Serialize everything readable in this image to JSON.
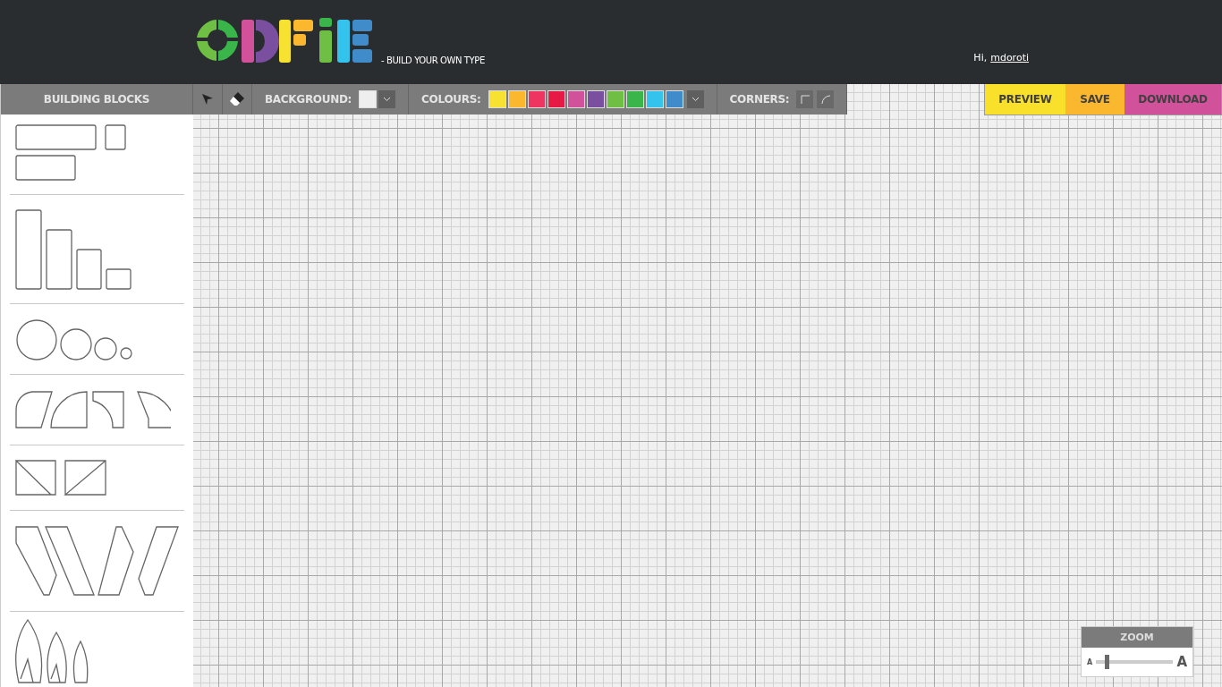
{
  "header": {
    "tagline": "- BUILD YOUR OWN TYPE",
    "greeting": "Hi,",
    "username": "mdoroti"
  },
  "sidebar": {
    "title": "BUILDING BLOCKS"
  },
  "toolbar": {
    "background_label": "BACKGROUND:",
    "colours_label": "COLOURS:",
    "corners_label": "CORNERS:",
    "swatches": [
      {
        "color": "#f8e231"
      },
      {
        "color": "#fbb72e"
      },
      {
        "color": "#ee3461"
      },
      {
        "color": "#e71a46"
      },
      {
        "color": "#d1529b"
      },
      {
        "color": "#7b4fa0"
      },
      {
        "color": "#6fbf45"
      },
      {
        "color": "#39b54a"
      },
      {
        "color": "#33c3ec"
      },
      {
        "color": "#408ccb"
      }
    ]
  },
  "actions": [
    {
      "label": "PREVIEW",
      "color": "#f9e02b"
    },
    {
      "label": "SAVE",
      "color": "#fbb72e"
    },
    {
      "label": "DOWNLOAD",
      "color": "#d1529b"
    }
  ],
  "zoom": {
    "title": "ZOOM",
    "small": "A",
    "large": "A",
    "level": 0.12
  }
}
